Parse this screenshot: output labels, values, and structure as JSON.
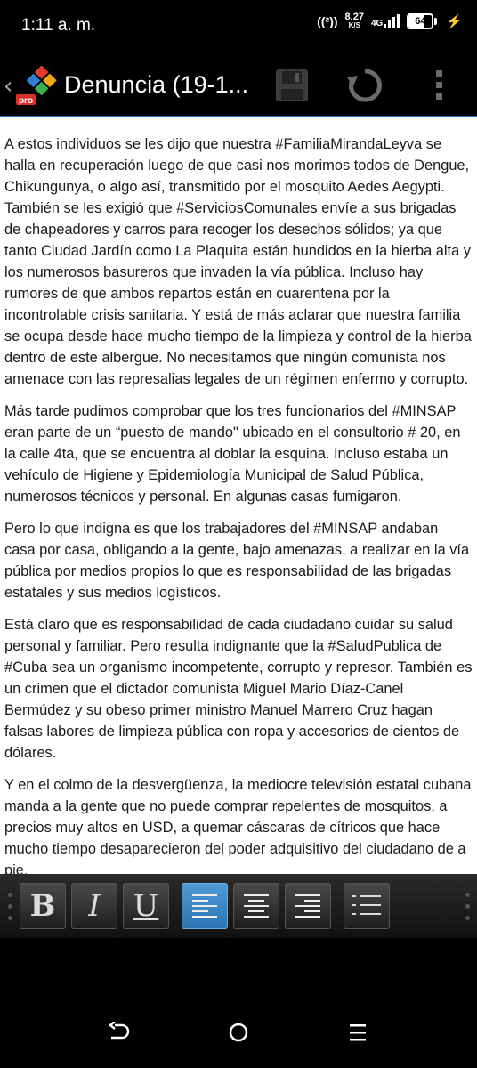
{
  "status_bar": {
    "time": "1:11 a. m.",
    "hotspot": "((²))",
    "net_speed_value": "8.27",
    "net_speed_unit": "K/S",
    "network_type": "4G",
    "battery": "64",
    "battery_level": 0.64
  },
  "app_bar": {
    "title": "Denuncia (19-1...",
    "logo_badge": "pro",
    "icons": [
      "back-icon",
      "app-logo-icon",
      "save-icon",
      "refresh-icon",
      "more-vert-icon"
    ]
  },
  "document": {
    "paragraphs": [
      "A estos individuos se les dijo que nuestra #FamiliaMirandaLeyva se halla en recuperación luego de que casi nos morimos todos de Dengue, Chikungunya, o algo así, transmitido por el mosquito Aedes Aegypti. También se les exigió que #ServiciosComunales envíe a sus brigadas de chapeadores y carros para recoger los desechos sólidos; ya que tanto Ciudad Jardín como La Plaquita están hundidos en la hierba alta y los numerosos basureros que invaden la vía pública. Incluso hay rumores de que ambos repartos están en cuarentena por la incontrolable crisis sanitaria. Y está de más aclarar que nuestra familia se ocupa desde hace mucho tiempo de la limpieza y control de la hierba dentro de este albergue. No necesitamos que ningún comunista nos amenace con las represalias legales de un régimen enfermo y corrupto.",
      "Más tarde pudimos comprobar que los tres funcionarios del #MINSAP eran parte de un “puesto de mando\" ubicado en el consultorio # 20, en la calle 4ta, que se encuentra al doblar la esquina. Incluso estaba un vehículo de Higiene y Epidemiología Municipal de Salud Pública, numerosos técnicos y personal. En algunas casas fumigaron.",
      "Pero lo que indigna es que los trabajadores del #MINSAP andaban casa por casa, obligando a la gente, bajo amenazas, a realizar en la vía pública por medios propios lo que es responsabilidad de las brigadas estatales y sus medios logísticos.",
      "Está claro que es responsabilidad de cada ciudadano cuidar su salud personal y familiar. Pero resulta indignante que la #SaludPublica de #Cuba sea un organismo incompetente, corrupto y represor. También es un crimen que el dictador comunista Miguel Mario Díaz-Canel Bermúdez y su obeso primer ministro Manuel Marrero Cruz hagan falsas labores de limpieza pública con ropa y accesorios de cientos de dólares.",
      "Y en el colmo de la desvergüenza, la mediocre televisión estatal cubana manda a la gente que no puede comprar repelentes de mosquitos, a precios muy altos en USD, a quemar cáscaras de cítricos que hace mucho tiempo desaparecieron del poder adquisitivo del ciudadano de a pie."
    ]
  },
  "format_toolbar": {
    "bold_label": "B",
    "italic_label": "I",
    "underline_label": "U",
    "active_alignment": "align-left",
    "accent_color": "#3a8ccc"
  },
  "nav_bar": {
    "icons": [
      "back-nav-icon",
      "home-icon",
      "recents-icon"
    ]
  }
}
